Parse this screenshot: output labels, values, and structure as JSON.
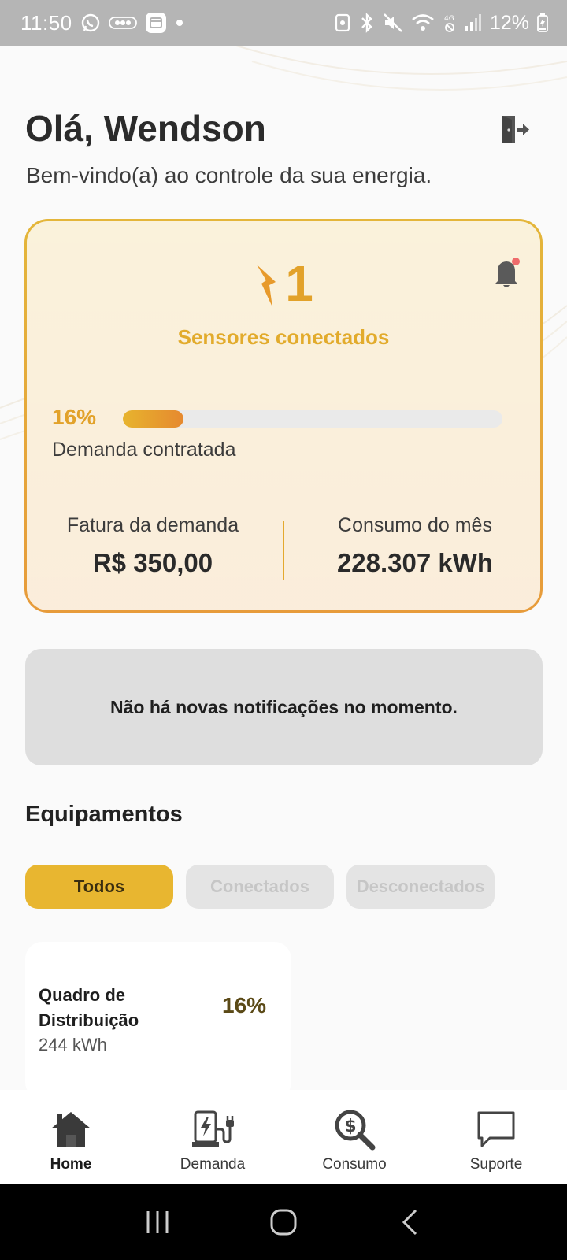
{
  "status_bar": {
    "time": "11:50",
    "battery": "12%"
  },
  "header": {
    "greeting": "Olá, Wendson",
    "subtitle": "Bem-vindo(a) ao controle da sua energia."
  },
  "summary": {
    "sensor_count": "1",
    "sensor_label": "Sensores conectados",
    "demand_percent": "16%",
    "demand_fraction": 0.16,
    "demand_label": "Demanda contratada",
    "invoice_label": "Fatura da demanda",
    "invoice_value": "R$ 350,00",
    "consumption_label": "Consumo do mês",
    "consumption_value": "228.307 kWh"
  },
  "notifications": {
    "empty_message": "Não há novas notificações no momento."
  },
  "equipments": {
    "title": "Equipamentos",
    "filters": [
      {
        "label": "Todos",
        "active": true
      },
      {
        "label": "Conectados",
        "active": false
      },
      {
        "label": "Desconectados",
        "active": false
      }
    ],
    "items": [
      {
        "name": "Quadro de Distribuição",
        "energy": "244 kWh",
        "percent": "16%"
      }
    ]
  },
  "bottom_nav": {
    "items": [
      {
        "label": "Home",
        "icon": "home-icon",
        "active": true
      },
      {
        "label": "Demanda",
        "icon": "ev-charger-icon",
        "active": false
      },
      {
        "label": "Consumo",
        "icon": "money-search-icon",
        "active": false
      },
      {
        "label": "Suporte",
        "icon": "chat-bubble-icon",
        "active": false
      }
    ]
  },
  "colors": {
    "accent": "#e8b630",
    "accent_orange": "#e6892f",
    "status_bar": "#b5b5b5"
  }
}
